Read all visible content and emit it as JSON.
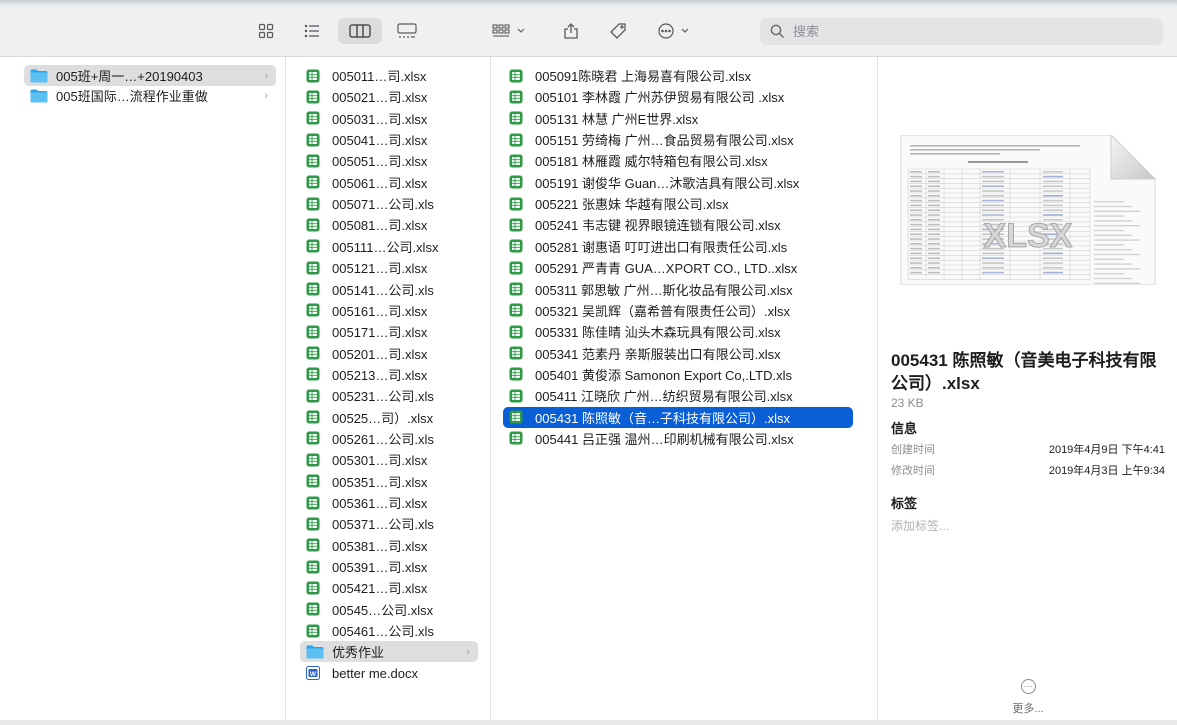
{
  "toolbar": {
    "icons": [
      "icon-view-icon",
      "list-view-icon",
      "column-view-icon",
      "gallery-view-icon",
      "group-icon",
      "share-icon",
      "tag-icon",
      "more-actions-icon"
    ],
    "search_placeholder": "搜索"
  },
  "col1": [
    {
      "name": "005班+周一…+20190403",
      "type": "folder",
      "state": "selected-gray"
    },
    {
      "name": "005班国际…流程作业重做",
      "type": "folder",
      "state": ""
    }
  ],
  "col2": [
    {
      "name": "005011…司.xlsx",
      "type": "xlsx"
    },
    {
      "name": "005021…司.xlsx",
      "type": "xlsx"
    },
    {
      "name": "005031…司.xlsx",
      "type": "xlsx"
    },
    {
      "name": "005041…司.xlsx",
      "type": "xlsx"
    },
    {
      "name": "005051…司.xlsx",
      "type": "xlsx"
    },
    {
      "name": "005061…司.xlsx",
      "type": "xlsx"
    },
    {
      "name": "005071…公司.xls",
      "type": "xlsx"
    },
    {
      "name": "005081…司.xlsx",
      "type": "xlsx"
    },
    {
      "name": "005111…公司.xlsx",
      "type": "xlsx"
    },
    {
      "name": "005121…司.xlsx",
      "type": "xlsx"
    },
    {
      "name": "005141…公司.xls",
      "type": "xlsx"
    },
    {
      "name": "005161…司.xlsx",
      "type": "xlsx"
    },
    {
      "name": "005171…司.xlsx",
      "type": "xlsx"
    },
    {
      "name": "005201…司.xlsx",
      "type": "xlsx"
    },
    {
      "name": "005213…司.xlsx",
      "type": "xlsx"
    },
    {
      "name": "005231…公司.xls",
      "type": "xlsx"
    },
    {
      "name": "00525…司）.xlsx",
      "type": "xlsx"
    },
    {
      "name": "005261…公司.xls",
      "type": "xlsx"
    },
    {
      "name": "005301…司.xlsx",
      "type": "xlsx"
    },
    {
      "name": "005351…司.xlsx",
      "type": "xlsx"
    },
    {
      "name": "005361…司.xlsx",
      "type": "xlsx"
    },
    {
      "name": "005371…公司.xls",
      "type": "xlsx"
    },
    {
      "name": "005381…司.xlsx",
      "type": "xlsx"
    },
    {
      "name": "005391…司.xlsx",
      "type": "xlsx"
    },
    {
      "name": "005421…司.xlsx",
      "type": "xlsx"
    },
    {
      "name": "00545…公司.xlsx",
      "type": "xlsx"
    },
    {
      "name": "005461…公司.xls",
      "type": "xlsx"
    },
    {
      "name": "优秀作业",
      "type": "folder",
      "state": "selected-gray"
    },
    {
      "name": "better me.docx",
      "type": "docx"
    }
  ],
  "col3": [
    {
      "name": "005091陈晓君 上海易喜有限公司.xlsx",
      "state": ""
    },
    {
      "name": "005101 李林霞  广州苏伊贸易有限公司 .xlsx",
      "state": ""
    },
    {
      "name": "005131 林慧  广州E世界.xlsx",
      "state": ""
    },
    {
      "name": "005151 劳绮梅 广州…食品贸易有限公司.xlsx",
      "state": ""
    },
    {
      "name": "005181 林雁霞 威尔特箱包有限公司.xlsx",
      "state": ""
    },
    {
      "name": "005191 谢俊华 Guan…沐歌洁具有限公司.xlsx",
      "state": ""
    },
    {
      "name": "005221 张惠妹 华越有限公司.xlsx",
      "state": ""
    },
    {
      "name": "005241 韦志键 视界眼镜连锁有限公司.xlsx",
      "state": ""
    },
    {
      "name": "005281 谢惠语  叮叮进出口有限责任公司.xls",
      "state": ""
    },
    {
      "name": "005291 严青青 GUA…XPORT CO., LTD..xlsx",
      "state": ""
    },
    {
      "name": "005311 郭思敏 广州…斯化妆品有限公司.xlsx",
      "state": ""
    },
    {
      "name": "005321 吴凯辉（嘉希普有限责任公司）.xlsx",
      "state": ""
    },
    {
      "name": "005331 陈佳晴 汕头木森玩具有限公司.xlsx",
      "state": ""
    },
    {
      "name": "005341 范素丹 亲斯服装出口有限公司.xlsx",
      "state": ""
    },
    {
      "name": "005401 黄俊添 Samonon Export Co,.LTD.xls",
      "state": ""
    },
    {
      "name": "005411 江晓欣 广州…纺织贸易有限公司.xlsx",
      "state": ""
    },
    {
      "name": "005431 陈照敏（音…子科技有限公司）.xlsx",
      "state": "selected-blue"
    },
    {
      "name": "005441 吕正强 温州…印刷机械有限公司.xlsx",
      "state": ""
    }
  ],
  "preview": {
    "badge": "XLSX",
    "filename": "005431 陈照敏（音美电子科技有限公司）.xlsx",
    "size": "23 KB",
    "info_heading": "信息",
    "info": [
      {
        "key": "创建时间",
        "value": "2019年4月9日 下午4:41"
      },
      {
        "key": "修改时间",
        "value": "2019年4月3日 上午9:34"
      }
    ],
    "tags_heading": "标签",
    "tags_placeholder": "添加标签...",
    "more_label": "更多..."
  },
  "colors": {
    "selection_blue": "#0a5fd6",
    "folder_blue": "#2aa3e8",
    "sheet_green": "#2e9a48",
    "word_blue": "#2b63c8"
  }
}
